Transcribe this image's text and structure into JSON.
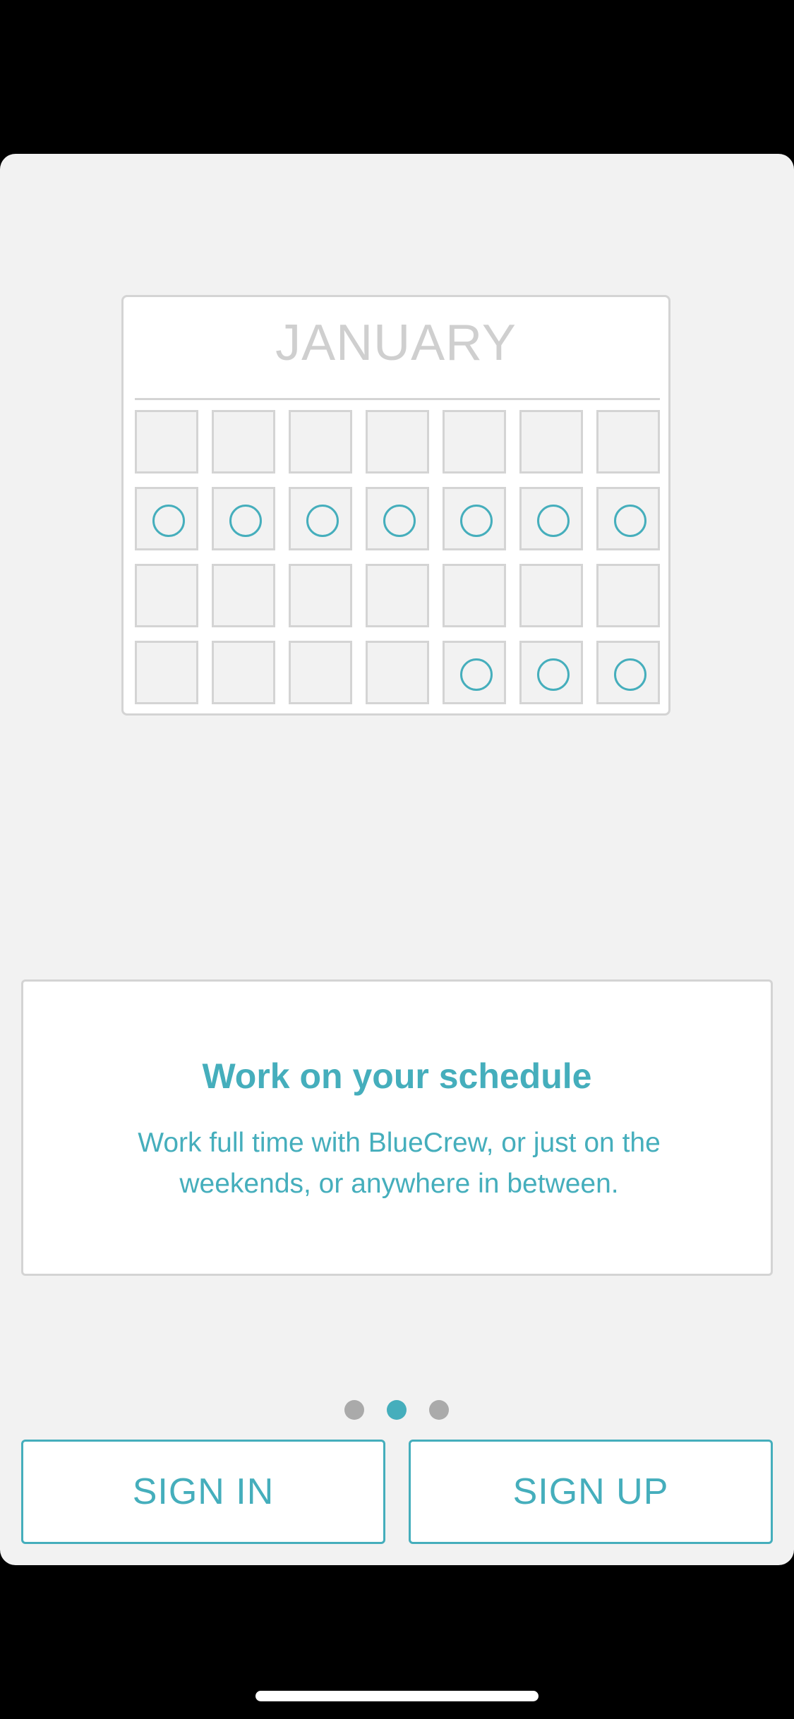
{
  "calendar": {
    "month": "JANUARY",
    "rows": [
      [
        false,
        false,
        false,
        false,
        false,
        false,
        false
      ],
      [
        true,
        true,
        true,
        true,
        true,
        true,
        true
      ],
      [
        false,
        false,
        false,
        false,
        false,
        false,
        false
      ],
      [
        false,
        false,
        false,
        false,
        true,
        true,
        true
      ]
    ]
  },
  "card": {
    "title": "Work on your schedule",
    "body": "Work full time with BlueCrew, or just on the weekends, or anywhere in between."
  },
  "pagination": {
    "total": 3,
    "active_index": 1
  },
  "buttons": {
    "sign_in": "SIGN IN",
    "sign_up": "SIGN UP"
  },
  "colors": {
    "accent": "#45aebc",
    "background": "#f2f2f2",
    "muted": "#cfcfcf"
  }
}
